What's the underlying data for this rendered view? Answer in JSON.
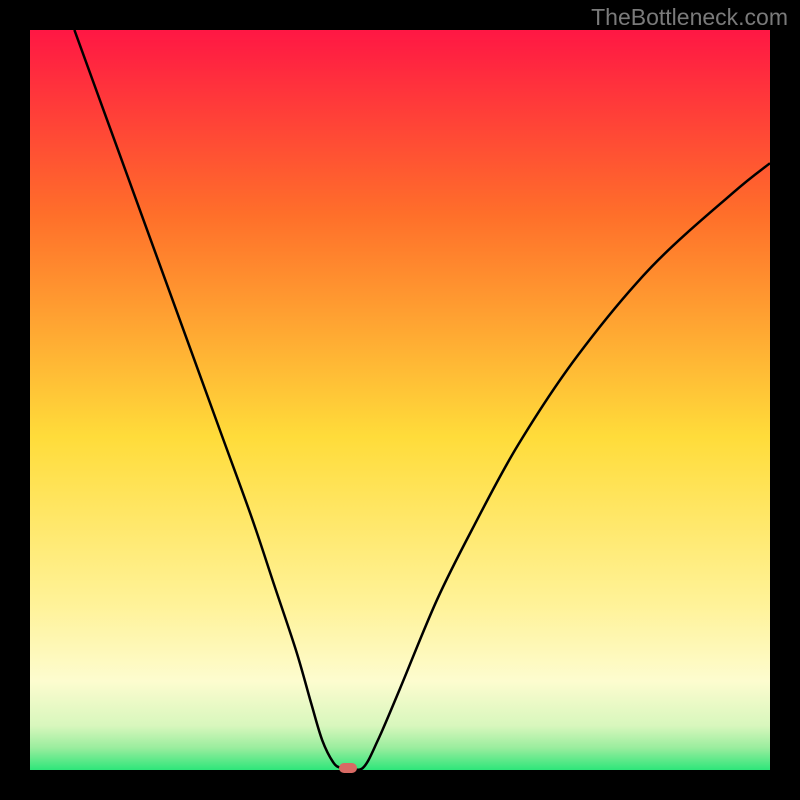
{
  "watermark": "TheBottleneck.com",
  "chart_data": {
    "type": "line",
    "title": "",
    "xlabel": "",
    "ylabel": "",
    "xlim": [
      0,
      100
    ],
    "ylim": [
      0,
      100
    ],
    "series": [
      {
        "name": "bottleneck-curve",
        "x": [
          6,
          10,
          14,
          18,
          22,
          26,
          30,
          33,
          36,
          38,
          39.5,
          41,
          42,
          43,
          45,
          47,
          50,
          55,
          60,
          66,
          74,
          84,
          95,
          100
        ],
        "values": [
          100,
          89,
          78,
          67,
          56,
          45,
          34,
          25,
          16,
          9,
          4,
          1,
          0.3,
          0.3,
          0.3,
          4,
          11,
          23,
          33,
          44,
          56,
          68,
          78,
          82
        ]
      }
    ],
    "marker": {
      "x": 43,
      "y": 0.3
    },
    "gradient_stops": [
      {
        "offset": 0.0,
        "color": "#ff1744"
      },
      {
        "offset": 0.25,
        "color": "#ff6f2a"
      },
      {
        "offset": 0.55,
        "color": "#ffdc3a"
      },
      {
        "offset": 0.78,
        "color": "#fff39a"
      },
      {
        "offset": 0.88,
        "color": "#fdfccf"
      },
      {
        "offset": 0.94,
        "color": "#d8f7bd"
      },
      {
        "offset": 0.97,
        "color": "#9aed9e"
      },
      {
        "offset": 1.0,
        "color": "#2ee67a"
      }
    ]
  }
}
